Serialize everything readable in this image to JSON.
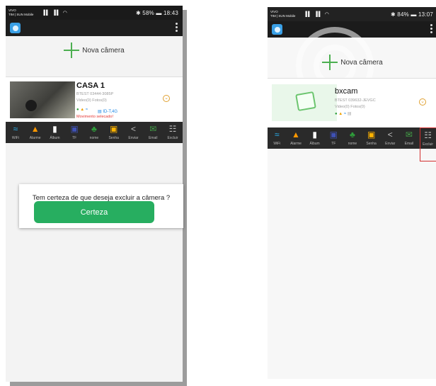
{
  "left_screen": {
    "status": {
      "carrier_top": "VIVO",
      "carrier_bottom": "TIM | SUN Mobile",
      "signal": "▐▌ ▐▌ ◠",
      "right": "✱ 58% ▬ 18:43"
    },
    "add_camera_label": "Nova câmera",
    "camera": {
      "name": "CASA 1",
      "uid": "BTEST 03444-3085P",
      "counts": "Video(0) Fotos(0)",
      "network": "▤ ID-T,4G",
      "motion": "Movimento selecado!"
    },
    "actions": [
      {
        "label": "WiFi",
        "icon": "≈"
      },
      {
        "label": "Alarme",
        "icon": "▲"
      },
      {
        "label": "Álbum",
        "icon": "▮"
      },
      {
        "label": "TF",
        "icon": "▣"
      },
      {
        "label": "nome",
        "icon": "♣"
      },
      {
        "label": "Senha",
        "icon": "▣"
      },
      {
        "label": "Enviar",
        "icon": "<"
      },
      {
        "label": "Email",
        "icon": "✉"
      },
      {
        "label": "Excluir",
        "icon": "☷"
      }
    ],
    "dialog": {
      "message": "Tem certeza de que deseja excluir a câmera ?",
      "confirm_label": "Certeza"
    }
  },
  "right_screen": {
    "status": {
      "carrier_top": "VIVO",
      "carrier_bottom": "TIM | SUN Mobile",
      "signal": "▐▌ ▐▌ ◠",
      "right": "✱ 84% ▬ 13:07"
    },
    "add_camera_label": "Nova câmera",
    "camera": {
      "name": "bxcam",
      "uid": "BTEST 039632-JEVGC",
      "counts": "Video(0) Fotos(0)"
    },
    "actions": [
      {
        "label": "WiFi",
        "icon": "≈"
      },
      {
        "label": "Alarme",
        "icon": "▲"
      },
      {
        "label": "Álbum",
        "icon": "▮"
      },
      {
        "label": "TF",
        "icon": "▣"
      },
      {
        "label": "nome",
        "icon": "♣"
      },
      {
        "label": "Senha",
        "icon": "▣"
      },
      {
        "label": "Enviar",
        "icon": "<"
      },
      {
        "label": "Email",
        "icon": "✉"
      },
      {
        "label": "Excluir",
        "icon": "☷"
      }
    ]
  },
  "colors": {
    "accent_green": "#27ae60",
    "highlight_red": "#d32f2f",
    "toolbar": "#2a2a2a"
  }
}
